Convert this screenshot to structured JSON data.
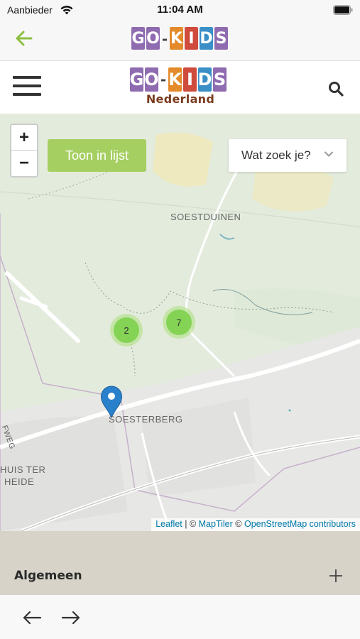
{
  "status_bar": {
    "carrier": "Aanbieder",
    "time": "11:04 AM"
  },
  "top_nav": {
    "back_icon": "arrow-left-icon"
  },
  "logo": {
    "letters": [
      {
        "char": "G",
        "color": "#8f6bb0"
      },
      {
        "char": "O",
        "color": "#8f6bb0"
      },
      {
        "char": "K",
        "color": "#e48a2a"
      },
      {
        "char": "I",
        "color": "#cf4b3c"
      },
      {
        "char": "D",
        "color": "#3b8fc7"
      },
      {
        "char": "S",
        "color": "#8f6bb0"
      }
    ],
    "dash": "-",
    "subtitle": "Nederland"
  },
  "site_header": {
    "menu_icon": "hamburger-icon",
    "search_icon": "search-icon"
  },
  "map": {
    "zoom_in": "+",
    "zoom_out": "−",
    "list_button": "Toon in lijst",
    "filter_placeholder": "Wat zoek je?",
    "places": {
      "soestduinen": "SOESTDUINEN",
      "soesterberg": "SOESTERBERG",
      "huis_ter": "HUIS TER",
      "heide": "HEIDE",
      "road_fragment": "FWEG"
    },
    "clusters": [
      {
        "count": "2"
      },
      {
        "count": "7"
      }
    ],
    "attribution": {
      "leaflet": "Leaflet",
      "sep": " | © ",
      "maptiler": "MapTiler",
      "mid": " © ",
      "osm": "OpenStreetMap contributors"
    }
  },
  "accordion": {
    "title": "Algemeen",
    "expand_icon": "plus-icon"
  },
  "bottom_nav": {
    "back_icon": "arrow-left-icon",
    "forward_icon": "arrow-right-icon"
  },
  "colors": {
    "accent": "#a6cf62",
    "back_arrow": "#8dbf3f",
    "cluster": "#6ecc39",
    "marker": "#2a81cb",
    "accordion_bg": "#d7d3c9"
  }
}
